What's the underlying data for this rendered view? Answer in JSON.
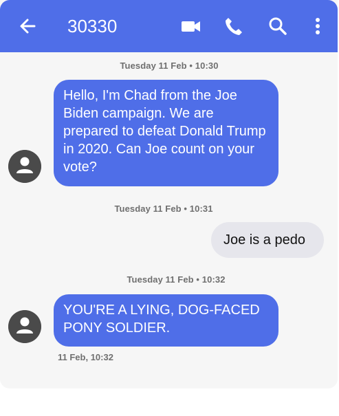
{
  "header": {
    "contact": "30330",
    "back_icon": "arrow-left-icon",
    "actions": [
      "video-call-icon",
      "phone-icon",
      "search-icon",
      "more-vert-icon"
    ]
  },
  "thread": {
    "stamp1": "Tuesday 11 Feb • 10:30",
    "msg1": "Hello, I'm Chad from the Joe Biden campaign. We are prepared to defeat Donald Trump in 2020. Can Joe count on your vote?",
    "stamp2": "Tuesday 11 Feb • 10:31",
    "msg2": "Joe is a pedo",
    "stamp3": "Tuesday 11 Feb • 10:32",
    "msg3": "YOU'RE A LYING, DOG-FACED PONY SOLDIER.",
    "msg3_time": "11 Feb, 10:32",
    "avatar_icon": "person-icon"
  },
  "colors": {
    "accent": "#4f6ee8",
    "outgoing_bubble": "#e6e6ec",
    "background": "#f6f6f6"
  }
}
